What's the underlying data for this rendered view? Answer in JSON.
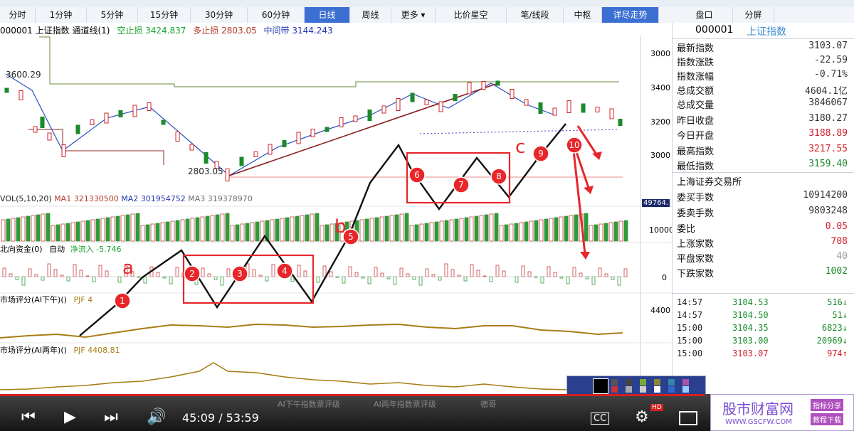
{
  "top_tabs": [
    {
      "label": "分时",
      "active": false
    },
    {
      "label": "1分钟",
      "active": false
    },
    {
      "label": "5分钟",
      "active": false
    },
    {
      "label": "15分钟",
      "active": false
    },
    {
      "label": "30分钟",
      "active": false
    },
    {
      "label": "60分钟",
      "active": false
    },
    {
      "label": "日线",
      "active": true
    },
    {
      "label": "周线",
      "active": false
    },
    {
      "label": "更多 ▾",
      "active": false
    },
    {
      "label": "比价星空",
      "active": false
    },
    {
      "label": "笔/线段",
      "active": false
    },
    {
      "label": "中枢",
      "active": false
    },
    {
      "label": "详尽走势",
      "active": true
    },
    {
      "label": "盘口",
      "active": false
    },
    {
      "label": "分屏",
      "active": false
    }
  ],
  "chart_header": {
    "code": "000001",
    "name": "上证指数",
    "indicator": "通道线(1)",
    "short_stop_label": "空止损",
    "short_stop_value": "3424.837",
    "long_stop_label": "多止损",
    "long_stop_value": "2803.05",
    "mid_label": "中间带",
    "mid_value": "3144.243"
  },
  "price_axis": [
    "3000",
    "3400",
    "3200",
    "3000"
  ],
  "annotations": {
    "high_label": "3600.29",
    "low_label": "2803.05",
    "vol_label": "VOL(5,10,20)",
    "ma1_label": "MA1",
    "ma1_value": "321330500",
    "ma2_label": "MA2",
    "ma2_value": "301954752",
    "ma3_label": "MA3",
    "ma3_value": "319378970",
    "vol_axis_top": "49764.",
    "vol_axis_bottom": "10000",
    "fund_label": "北向资金(0)",
    "fund_auto": "自动",
    "fund_flow": "净流入",
    "fund_value": "-5.746",
    "fund_zero": "0",
    "score1_label": "市场评分(AI下午)()",
    "score1_value": "PJF 4",
    "score1_axis": "4400",
    "score2_label": "市场评分(AI两年)()",
    "score2_value": "PJF 4408.81",
    "wave_a": "a",
    "wave_b": "b",
    "wave_c": "c",
    "points": [
      "1",
      "2",
      "3",
      "4",
      "5",
      "6",
      "7",
      "8",
      "9",
      "10"
    ]
  },
  "right_panel": {
    "code": "000001",
    "name": "上证指数",
    "rows": [
      {
        "label": "最新指数",
        "value": "3103.07"
      },
      {
        "label": "指数涨跌",
        "value": "-22.59"
      },
      {
        "label": "指数涨幅",
        "value": "-0.71%"
      },
      {
        "label": "总成交额",
        "value": "4604.1亿"
      },
      {
        "label": "总成交量",
        "value": "3846067"
      },
      {
        "label": "昨日收盘",
        "value": "3180.27"
      },
      {
        "label": "今日开盘",
        "value": "3188.89"
      },
      {
        "label": "最高指数",
        "value": "3217.55"
      },
      {
        "label": "最低指数",
        "value": "3159.40"
      }
    ],
    "exchange": "上海证券交易所",
    "rows2": [
      {
        "label": "委买手数",
        "value": "10914200"
      },
      {
        "label": "委卖手数",
        "value": "9803248"
      },
      {
        "label": "委比",
        "value": "0.05"
      },
      {
        "label": "上涨家数",
        "value": "708"
      },
      {
        "label": "平盘家数",
        "value": "40"
      },
      {
        "label": "下跌家数",
        "value": "1002"
      }
    ],
    "ticks": [
      {
        "time": "14:57",
        "price": "3104.53",
        "vol": "516↓"
      },
      {
        "time": "14:57",
        "price": "3104.50",
        "vol": "51↓"
      },
      {
        "time": "15:00",
        "price": "3104.35",
        "vol": "6823↓"
      },
      {
        "time": "15:00",
        "price": "3103.00",
        "vol": "20969↓"
      },
      {
        "time": "15:00",
        "price": "3103.07",
        "vol": "974↑"
      }
    ]
  },
  "player": {
    "time": "45:09 / 53:59",
    "hd": "HD",
    "cc": "CC"
  },
  "bottom_hints": [
    "AI下午指数票评级",
    "AI两年指数票评级",
    "德哥"
  ],
  "watermark": {
    "title": "股市财富网",
    "url": "WWW.GSCFW.COM",
    "tag1": "指标分享",
    "tag2": "教程下载"
  },
  "colors": {
    "accent": "#3b6fd1",
    "up": "#d3202a",
    "down": "#1a8a2a",
    "annotation": "#e8262a"
  }
}
